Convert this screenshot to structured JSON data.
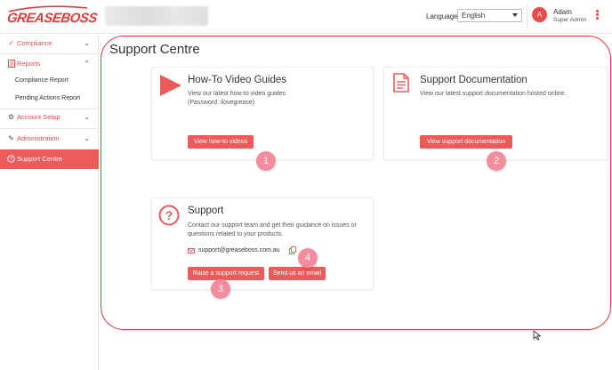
{
  "app": {
    "logo_text": "GREASEBOSS"
  },
  "header": {
    "language_label": "Language:",
    "language_value": "English",
    "user_initial": "A",
    "user_name": "Adam",
    "user_role": "Super Admin"
  },
  "sidebar": {
    "items": [
      {
        "label": "Compliance",
        "icon": "check-icon"
      },
      {
        "label": "Reports",
        "icon": "document-icon"
      },
      {
        "label": "Account Setup",
        "icon": "gear-icon"
      },
      {
        "label": "Administration",
        "icon": "pencil-icon"
      },
      {
        "label": "Support Centre",
        "icon": "question-circle-icon"
      }
    ],
    "report_subitems": [
      "Compliance Report",
      "Pending Actions Report"
    ]
  },
  "main": {
    "title": "Support Centre",
    "cards": {
      "videos": {
        "title": "How-To Video Guides",
        "line1": "View our latest how-to video guides",
        "line2": "(Password: ilovegrease)",
        "button": "View how-to videos"
      },
      "docs": {
        "title": "Support Documentation",
        "line1": "View our latest support documentation hosted online.",
        "button": "View support documentation"
      },
      "support": {
        "title": "Support",
        "line1": "Contact our support team and get their guidance on issues or",
        "line2": "questions related to your products.",
        "email": "support@greaseboss.com.au",
        "button_request": "Raise a support request",
        "button_email": "Send us an email"
      }
    },
    "badges": [
      "1",
      "2",
      "3",
      "4"
    ]
  },
  "colors": {
    "accent": "#ec5a5a",
    "highlight": "#e03a3a",
    "badge": "#f28d9e"
  }
}
